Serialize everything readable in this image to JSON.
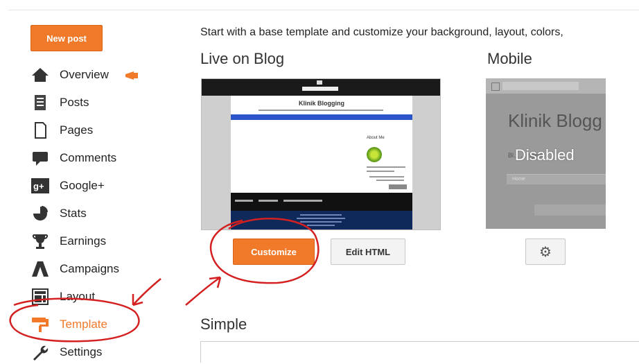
{
  "sidebar": {
    "new_post": "New post",
    "items": [
      {
        "label": "Overview",
        "icon": "home-icon"
      },
      {
        "label": "Posts",
        "icon": "posts-icon"
      },
      {
        "label": "Pages",
        "icon": "pages-icon"
      },
      {
        "label": "Comments",
        "icon": "comments-icon"
      },
      {
        "label": "Google+",
        "icon": "google-plus-icon"
      },
      {
        "label": "Stats",
        "icon": "stats-icon"
      },
      {
        "label": "Earnings",
        "icon": "trophy-icon"
      },
      {
        "label": "Campaigns",
        "icon": "campaigns-icon"
      },
      {
        "label": "Layout",
        "icon": "layout-icon"
      },
      {
        "label": "Template",
        "icon": "template-icon",
        "active": true
      },
      {
        "label": "Settings",
        "icon": "wrench-icon"
      }
    ]
  },
  "main": {
    "intro": "Start with a base template and customize your background, layout, colors,",
    "live_heading": "Live on Blog",
    "mobile_heading": "Mobile",
    "simple_heading": "Simple",
    "preview": {
      "blog_title": "Klinik Blogging",
      "sidebar_heading": "About Me"
    },
    "mobile_preview": {
      "blog_title": "Klinik Blogg",
      "text": "Bl... ... ngebl",
      "disabled_label": "Disabled",
      "home_label": "Home"
    },
    "customize_label": "Customize",
    "edit_html_label": "Edit HTML"
  },
  "colors": {
    "accent": "#f07a2a",
    "annotation": "#d42020"
  }
}
